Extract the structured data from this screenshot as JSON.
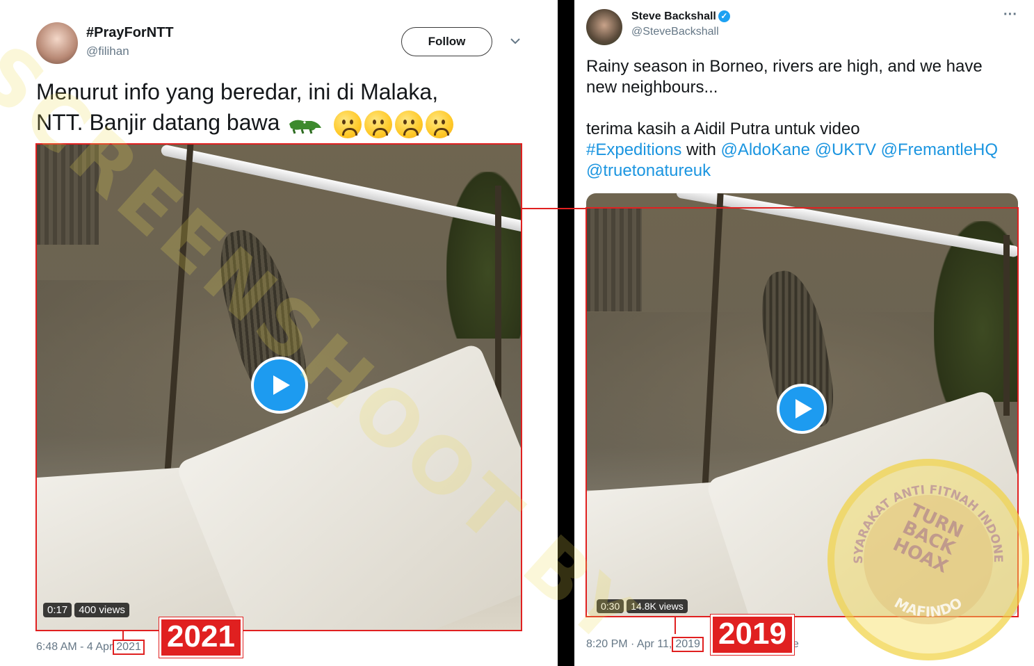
{
  "left_tweet": {
    "display_name": "#PrayForNTT",
    "handle": "@filihan",
    "follow_label": "Follow",
    "text_line1": "Menurut info yang beredar, ini di Malaka,",
    "text_line2": "NTT. Banjir datang bawa",
    "emoji_icons": [
      "crocodile-emoji",
      "frowning-face-emoji",
      "frowning-face-emoji",
      "frowning-face-emoji",
      "frowning-face-emoji"
    ],
    "video_duration": "0:17",
    "video_views": "400 views",
    "timestamp_prefix": "6:48 AM - 4 Apr",
    "timestamp_year": "2021"
  },
  "right_tweet": {
    "display_name": "Steve Backshall",
    "verified_icon": "verified-badge-icon",
    "handle": "@SteveBackshall",
    "more_icon": "···",
    "text_line1": "Rainy season in Borneo, rivers are high, and we have",
    "text_line2": "new neighbours...",
    "text_line3": "terima kasih a Aidil Putra untuk video",
    "hashtag": "#Expeditions",
    "with_word": "with",
    "mention1": "@AldoKane",
    "mention2": "@UKTV",
    "mention3": "@FremantleHQ",
    "mention4": "@truetonatureuk",
    "video_duration": "0:30",
    "video_views": "14.8K views",
    "timestamp_prefix": "8:20 PM · Apr 11,",
    "timestamp_year": "2019",
    "timestamp_suffix": "e"
  },
  "annotations": {
    "left_year_label": "2021",
    "right_year_label": "2019",
    "highlight_color": "#e02020"
  },
  "watermark": {
    "text": "SCREENSHOOT BY",
    "seal_top_text": "MASYARAKAT ANTI FITNAH INDONESIA",
    "seal_bottom_text": "MAFINDO",
    "seal_center_line1": "TURN",
    "seal_center_line2": "BACK",
    "seal_center_line3": "HOAX"
  },
  "colors": {
    "link_blue": "#1b95e0",
    "play_blue": "#1d9bf0",
    "handle_gray": "#657786"
  }
}
